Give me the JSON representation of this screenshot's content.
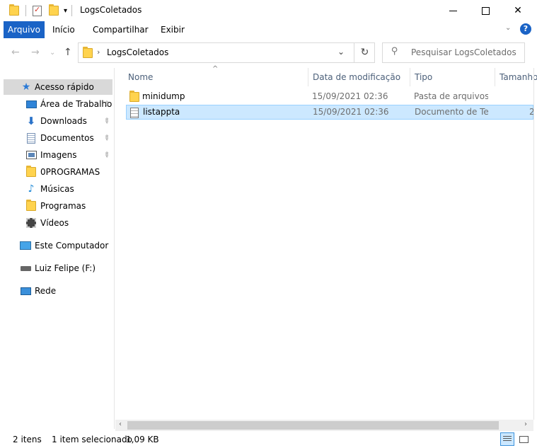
{
  "window": {
    "title": "LogsColetados",
    "qa_dropdown": "▾",
    "minimize": "",
    "maximize": "",
    "close": "✕"
  },
  "ribbon": {
    "tabs": [
      {
        "label": "Arquivo"
      },
      {
        "label": "Início"
      },
      {
        "label": "Compartilhar"
      },
      {
        "label": "Exibir"
      }
    ],
    "expand_glyph": "⌄",
    "help": "?"
  },
  "nav": {
    "back": "←",
    "forward": "→",
    "recent": "⌄",
    "up": "↑"
  },
  "address": {
    "separator": "›",
    "crumb": "LogsColetados",
    "dropdown": "⌄",
    "refresh": "↻"
  },
  "search": {
    "placeholder": "Pesquisar LogsColetados",
    "icon_glyph": "⚲"
  },
  "sidebar": {
    "items": [
      {
        "label": "Acesso rápido",
        "icon": "star-icon",
        "selected": true
      },
      {
        "label": "Área de Trabalho",
        "icon": "desktop-icon",
        "pinned": true
      },
      {
        "label": "Downloads",
        "icon": "download-icon",
        "pinned": true
      },
      {
        "label": "Documentos",
        "icon": "documents-icon",
        "pinned": true
      },
      {
        "label": "Imagens",
        "icon": "pictures-icon",
        "pinned": true
      },
      {
        "label": "0PROGRAMAS",
        "icon": "folder-icon"
      },
      {
        "label": "Músicas",
        "icon": "music-icon"
      },
      {
        "label": "Programas",
        "icon": "folder-icon"
      },
      {
        "label": "Vídeos",
        "icon": "videos-icon"
      },
      {
        "label": "Este Computador",
        "icon": "computer-icon"
      },
      {
        "label": "Luiz Felipe (F:)",
        "icon": "drive-icon"
      },
      {
        "label": "Rede",
        "icon": "network-icon"
      }
    ],
    "pin_glyph": "📌"
  },
  "columns": {
    "name": "Nome",
    "date": "Data de modificação",
    "type": "Tipo",
    "size": "Tamanho",
    "sort_caret": "^"
  },
  "files": [
    {
      "name": "minidump",
      "date": "15/09/2021 02:36",
      "type": "Pasta de arquivos",
      "size": "",
      "icon": "folder-icon",
      "selected": false
    },
    {
      "name": "listappta",
      "date": "15/09/2021 02:36",
      "type": "Documento de Te...",
      "size": "2",
      "icon": "text-file-icon",
      "selected": true
    }
  ],
  "scroll": {
    "left": "‹",
    "right": "›"
  },
  "status": {
    "count": "2 itens",
    "selected": "1 item selecionado",
    "size": "1,09 KB"
  },
  "colors": {
    "accent": "#1a63c6",
    "selection": "#cce8ff",
    "selection_border": "#99d1ff",
    "sidebar_selected": "#d9d9d9"
  }
}
